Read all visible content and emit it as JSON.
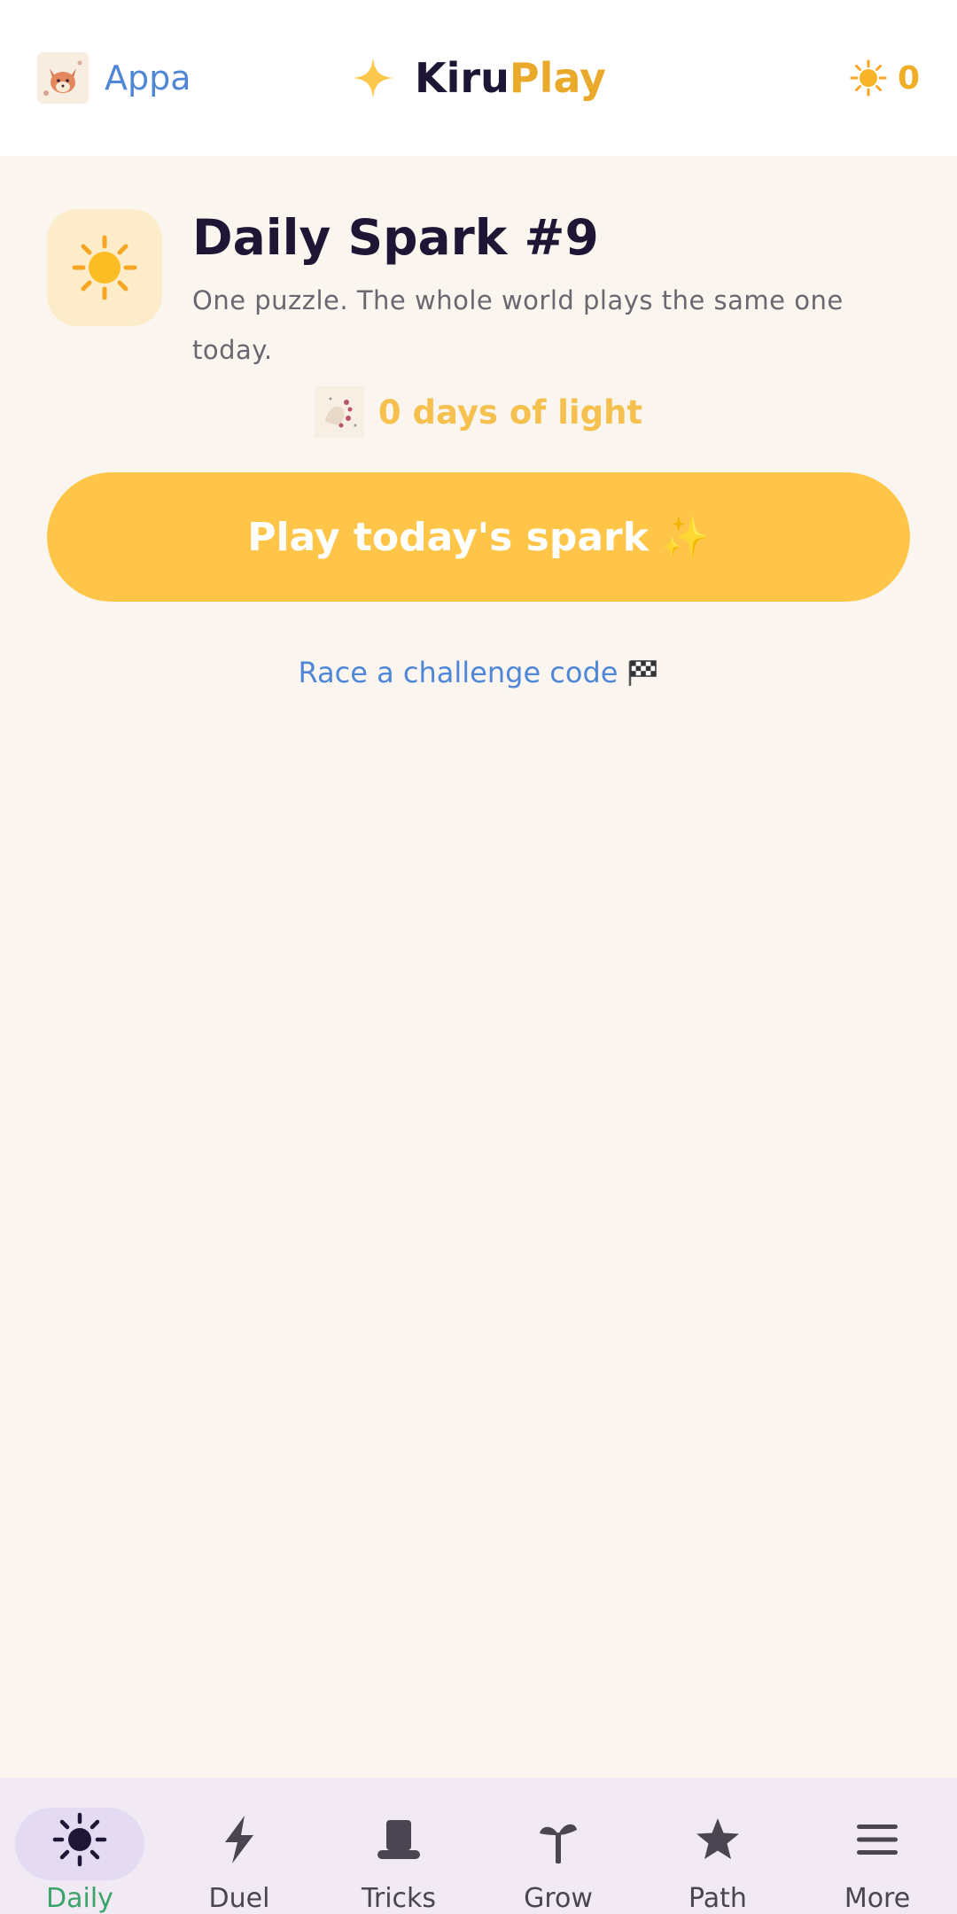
{
  "header": {
    "profile_name": "Appa",
    "logo_part_a": "Kiru",
    "logo_part_b": "Play",
    "suns_count": "0"
  },
  "daily": {
    "title": "Daily Spark #9",
    "subtitle": "One puzzle. The whole world plays the same one today.",
    "streak_label": "0 days of light",
    "play_button": "Play today's spark",
    "play_button_emoji": "✨",
    "race_link": "Race a challenge code",
    "race_link_emoji": "🏁"
  },
  "bottom_nav": {
    "items": [
      {
        "label": "Daily",
        "icon": "sun-icon",
        "active": true
      },
      {
        "label": "Duel",
        "icon": "lightning-icon",
        "active": false
      },
      {
        "label": "Tricks",
        "icon": "top-hat-icon",
        "active": false
      },
      {
        "label": "Grow",
        "icon": "sprout-icon",
        "active": false
      },
      {
        "label": "Path",
        "icon": "star-icon",
        "active": false
      },
      {
        "label": "More",
        "icon": "menu-icon",
        "active": false
      }
    ]
  },
  "colors": {
    "accent_yellow": "#fec548",
    "link_blue": "#4f86d6",
    "active_green": "#3aa46a",
    "nav_background": "#f1eaf5"
  }
}
